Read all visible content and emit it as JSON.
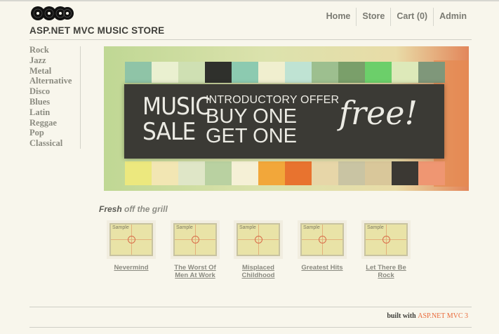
{
  "site": {
    "title": "ASP.NET MVC MUSIC STORE"
  },
  "nav": {
    "items": [
      "Home",
      "Store",
      "Cart (0)",
      "Admin"
    ]
  },
  "genres": [
    "Rock",
    "Jazz",
    "Metal",
    "Alternative",
    "Disco",
    "Blues",
    "Latin",
    "Reggae",
    "Pop",
    "Classical"
  ],
  "banner": {
    "music": "MUSIC",
    "sale": "SALE",
    "offer": "INTRODUCTORY OFFER",
    "buy": "BUY ONE",
    "get": "GET ONE",
    "free": "free!"
  },
  "fresh": {
    "bold": "Fresh",
    "rest": "off the grill"
  },
  "albums": [
    {
      "title_line1": "Nevermind",
      "title_line2": ""
    },
    {
      "title_line1": "The Worst Of",
      "title_line2": "Men At Work"
    },
    {
      "title_line1": "Misplaced",
      "title_line2": "Childhood"
    },
    {
      "title_line1": "Greatest Hits",
      "title_line2": ""
    },
    {
      "title_line1": "Let There Be",
      "title_line2": "Rock"
    }
  ],
  "thumb_label": "Sample",
  "footer": {
    "prefix": "built with",
    "brand": "ASP.NET MVC 3"
  },
  "colors": {
    "background": "#f8f6ec",
    "accent": "#e96a3b",
    "banner_panel": "#3b3a35"
  }
}
